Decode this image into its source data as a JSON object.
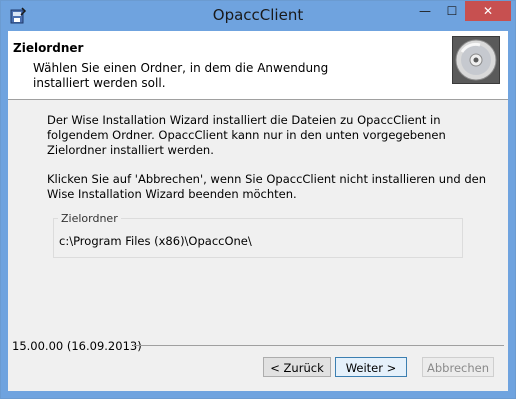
{
  "window": {
    "title": "OpaccClient",
    "minimize_glyph": "—",
    "maximize_glyph": "☐",
    "close_glyph": "✕",
    "app_icon": "installer-icon",
    "accent_color": "#6fa3df",
    "close_color": "#c75050"
  },
  "header": {
    "title": "Zielordner",
    "description": "Wählen Sie einen Ordner, in dem die Anwendung installiert werden soll.",
    "icon": "disc-icon"
  },
  "body": {
    "paragraph1": "Der Wise Installation Wizard installiert die Dateien zu OpaccClient in folgendem Ordner. OpaccClient kann nur in den unten vorgegebenen Zielordner installiert werden.",
    "paragraph2": "Klicken Sie auf 'Abbrechen', wenn Sie OpaccClient nicht installieren und den Wise Installation Wizard beenden möchten.",
    "group_label": "Zielordner",
    "folder_path": "c:\\Program Files (x86)\\OpaccOne\\"
  },
  "footer": {
    "version": "15.00.00 (16.09.2013)",
    "back_label": "< Zurück",
    "next_label": "Weiter >",
    "cancel_label": "Abbrechen"
  }
}
